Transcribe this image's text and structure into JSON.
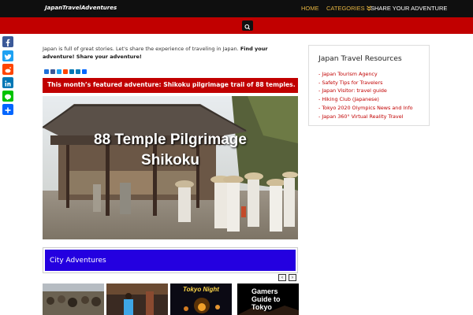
{
  "header": {
    "logo": "JapanTravelAdventures",
    "nav": {
      "home": "HOME",
      "categories": "CATEGORIES",
      "categories_icon": "chevron-double-down-icon",
      "share": "SHARE YOUR ADVENTURE"
    },
    "search_icon": "search-icon"
  },
  "social_icons": [
    {
      "name": "facebook-icon",
      "color": "#3b5998"
    },
    {
      "name": "twitter-icon",
      "color": "#1da1f2"
    },
    {
      "name": "reddit-icon",
      "color": "#ff4500"
    },
    {
      "name": "linkedin-icon",
      "color": "#0077b5"
    },
    {
      "name": "line-icon",
      "color": "#00c300"
    },
    {
      "name": "share-icon",
      "color": "#0166ff"
    }
  ],
  "intro": {
    "text": "Japan is full of great stories.  Let's share the experience of traveling in Japan.",
    "bold": "Find your adventure! Share your adventure!"
  },
  "share_icons": [
    "share-a-icon",
    "share-b-icon",
    "share-c-icon",
    "share-d-icon",
    "share-e-icon",
    "share-f-icon",
    "share-g-icon"
  ],
  "featured": {
    "label": "This month’s featured adventure: Shikoku pilgrimage trail of 88 temples.",
    "image_title_line1": "88 Temple Pilgrimage",
    "image_title_line2": "Shikoku"
  },
  "city_section": {
    "title": "City Adventures",
    "prev": "‹",
    "next": "›",
    "thumbs": [
      {
        "name": "thumb-crowd",
        "caption": ""
      },
      {
        "name": "thumb-kimono",
        "caption": ""
      },
      {
        "name": "thumb-tokyo-night",
        "caption": "Tokyo Night"
      },
      {
        "name": "thumb-gamers",
        "caption": "Gamers Guide to Tokyo"
      }
    ]
  },
  "sidebar": {
    "title": "Japan Travel Resources",
    "links": [
      "- Japan Tourism Agency",
      "- Safety Tips for Travelers",
      "- Japan Visitor: travel guide",
      "- Hiking Club (Japanese)",
      "- Tokyo 2020 Olympics News and Info",
      "- Japan 360° Virtual Reality Travel"
    ]
  },
  "colors": {
    "accent": "#c10000",
    "nav_active": "#e3b341",
    "topbar": "#0f0f0f",
    "city_bar": "#2400e0",
    "link": "#c10000"
  }
}
